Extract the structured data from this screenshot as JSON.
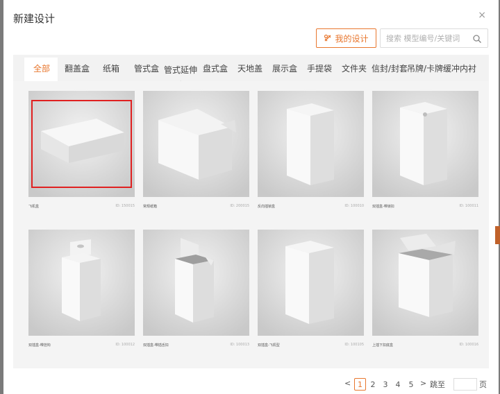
{
  "dialog": {
    "title": "新建设计",
    "close": "×",
    "my_design_label": "我的设计",
    "search_placeholder": "搜索 模型编号/关键词"
  },
  "tabs": [
    {
      "label": "全部",
      "active": true
    },
    {
      "label": "翻盖盒"
    },
    {
      "label": "纸箱"
    },
    {
      "label": "管式盒"
    },
    {
      "label": "管式延伸盒"
    },
    {
      "label": "盘式盒"
    },
    {
      "label": "天地盖"
    },
    {
      "label": "展示盒"
    },
    {
      "label": "手提袋"
    },
    {
      "label": "文件夹"
    },
    {
      "label": "信封/封套"
    },
    {
      "label": "吊牌/卡牌"
    },
    {
      "label": "缓冲内衬"
    }
  ],
  "items": [
    {
      "caption": "飞机盒",
      "id": "ID: 150015",
      "selected": true,
      "shape": "flat-box"
    },
    {
      "caption": "常规纸箱",
      "id": "ID: 200015",
      "shape": "open-carton"
    },
    {
      "caption": "反向插锁盒",
      "id": "ID: 100010",
      "shape": "tall-box"
    },
    {
      "caption": "双插盒-带锁扣",
      "id": "ID: 100011",
      "shape": "tall-box-lock"
    },
    {
      "caption": "双插盒-带挂钩",
      "id": "ID: 100012",
      "shape": "hook-box"
    },
    {
      "caption": "双插盒-带插舌扣",
      "id": "ID: 100013",
      "shape": "open-tall-box"
    },
    {
      "caption": "双插盒-飞机型",
      "id": "ID: 100105",
      "shape": "tall-box-2"
    },
    {
      "caption": "上插下扣底盒",
      "id": "ID: 100016",
      "shape": "open-lid-box"
    }
  ],
  "pagination": {
    "prev": "<",
    "pages": [
      "1",
      "2",
      "3",
      "4",
      "5"
    ],
    "current": "1",
    "next": ">",
    "jump_label": "跳至",
    "page_unit": "页"
  },
  "colors": {
    "accent": "#e8762d",
    "selection": "#e02020"
  },
  "icons": {
    "my_design": "pencil-ruler-icon",
    "search": "search-icon",
    "close": "close-icon"
  }
}
